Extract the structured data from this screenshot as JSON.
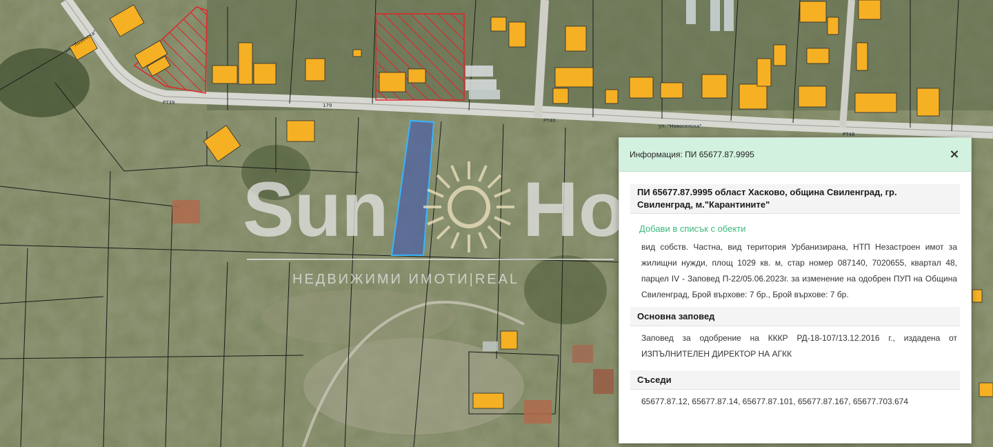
{
  "map": {
    "road_labels": {
      "upper_left": "ул. \"Лозенска\"",
      "pt39": "PT39",
      "pt40": "PT40",
      "pt48": "PT48",
      "novoselska": "ул. \"Новоселска\"",
      "num_179": "179"
    },
    "selected_parcel_color": "#39b5ff",
    "building_color": "#f6b024",
    "hatch_color": "#e0242a",
    "boundary_color": "#1a1a1a"
  },
  "watermark": {
    "brand_left": "Sun",
    "brand_right": "Ho",
    "tagline": "НЕДВИЖИМИ ИМОТИ|REAL"
  },
  "info_panel": {
    "title": "Информация: ПИ 65677.87.9995",
    "close_label": "×",
    "heading": "ПИ 65677.87.9995 област Хасково, община Свиленград, гр. Свиленград, м.\"Карантините\"",
    "add_link": "Добави в списък с обекти",
    "description": "вид собств. Частна, вид територия Урбанизирана, НТП Незастроен имот за жилищни нужди, площ 1029 кв. м, стар номер 087140, 7020655, квартал 48, парцел IV - Заповед П-22/05.06.2023г. за изменение на одобрен ПУП на Община Свиленград, Брой върхове: 7 бр., Брой върхове: 7 бр.",
    "section_order_title": "Основна заповед",
    "section_order_text": "Заповед за одобрение на КККР РД-18-107/13.12.2016 г., издадена от ИЗПЪЛНИТЕЛЕН ДИРЕКТОР НА АГКК",
    "section_neighbors_title": "Съседи",
    "section_neighbors_text": "65677.87.12, 65677.87.14, 65677.87.101, 65677.87.167, 65677.703.674"
  }
}
